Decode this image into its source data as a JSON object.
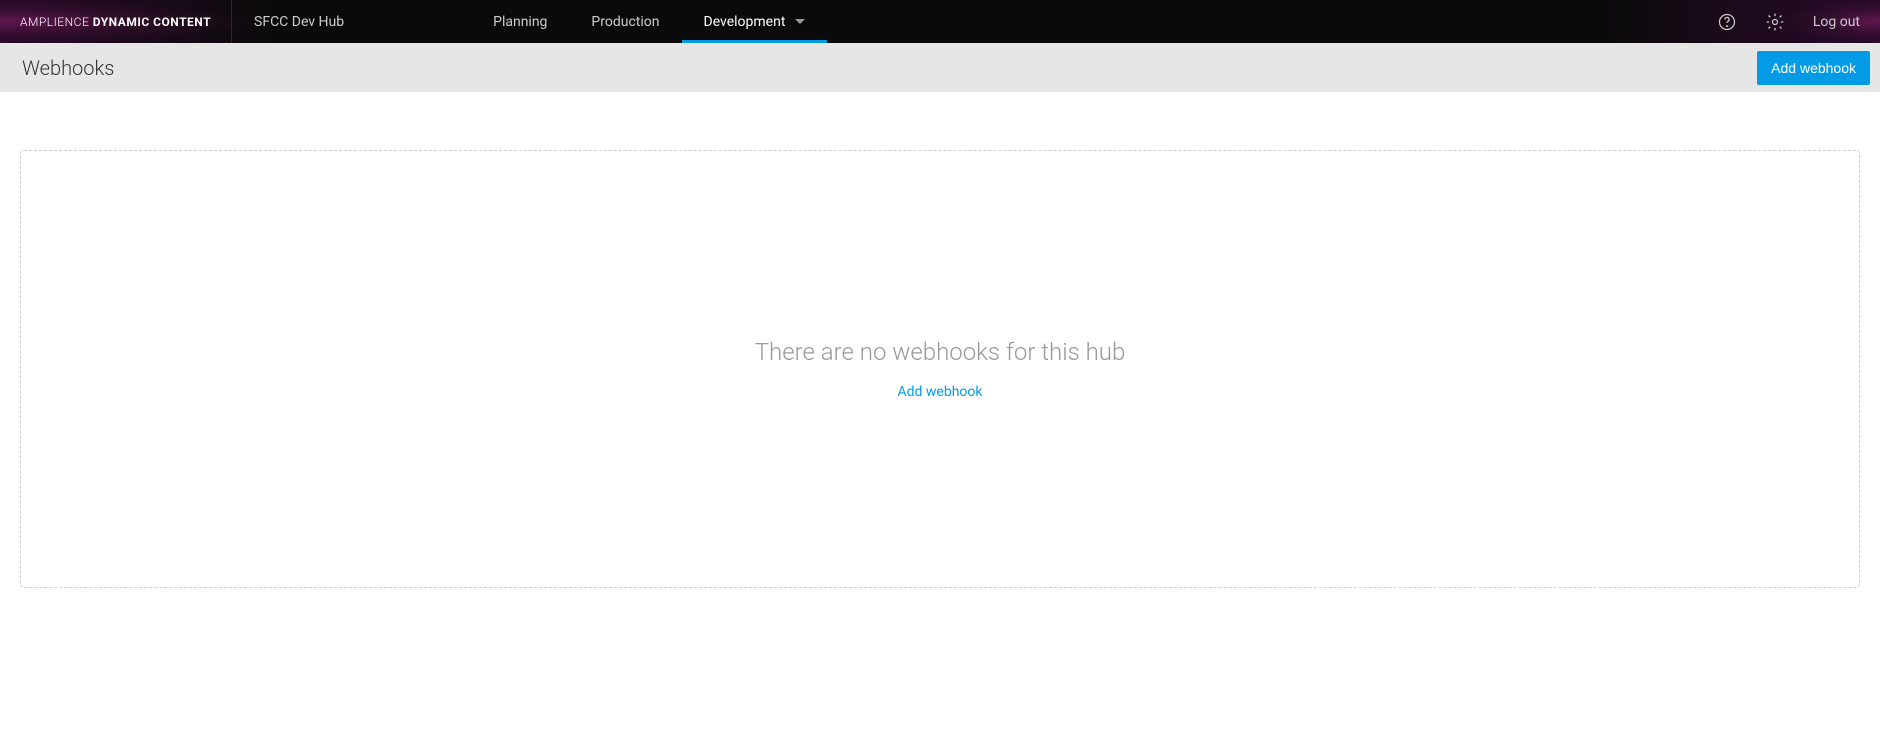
{
  "brand": {
    "light": "AMPLIENCE ",
    "bold": "DYNAMIC CONTENT"
  },
  "hub_name": "SFCC Dev Hub",
  "nav_tabs": {
    "planning": "Planning",
    "production": "Production",
    "development": "Development"
  },
  "logout_label": "Log out",
  "subheader": {
    "title": "Webhooks",
    "add_button": "Add webhook"
  },
  "empty_state": {
    "message": "There are no webhooks for this hub",
    "link_label": "Add webhook"
  }
}
